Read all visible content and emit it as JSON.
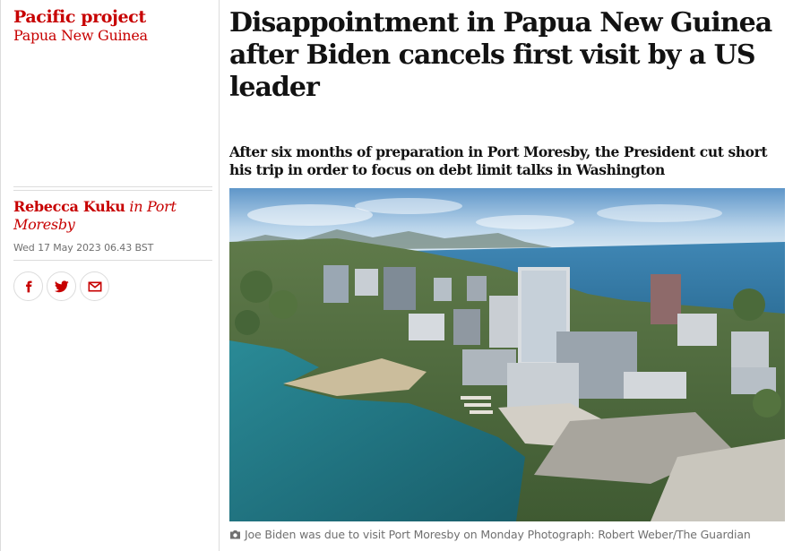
{
  "series": {
    "title": "Pacific project",
    "subtitle": "Papua New Guinea"
  },
  "byline": {
    "author": "Rebecca Kuku",
    "location": "in Port Moresby",
    "date": "Wed 17 May 2023 06.43 BST"
  },
  "share": {
    "facebook_icon": "facebook-icon",
    "twitter_icon": "twitter-icon",
    "email_icon": "email-icon"
  },
  "article": {
    "headline": "Disappointment in Papua New Guinea after Biden cancels first visit by a US leader",
    "standfirst": "After six months of preparation in Port Moresby, the President cut short his trip in order to focus on debt limit talks in Washington"
  },
  "image": {
    "caption": "Joe Biden was due to visit Port Moresby on Monday Photograph: Robert Weber/The Guardian",
    "caption_icon": "camera-icon"
  },
  "colors": {
    "accent": "#c70000",
    "text": "#121212",
    "muted": "#707070",
    "rule": "#dcdcdc"
  }
}
